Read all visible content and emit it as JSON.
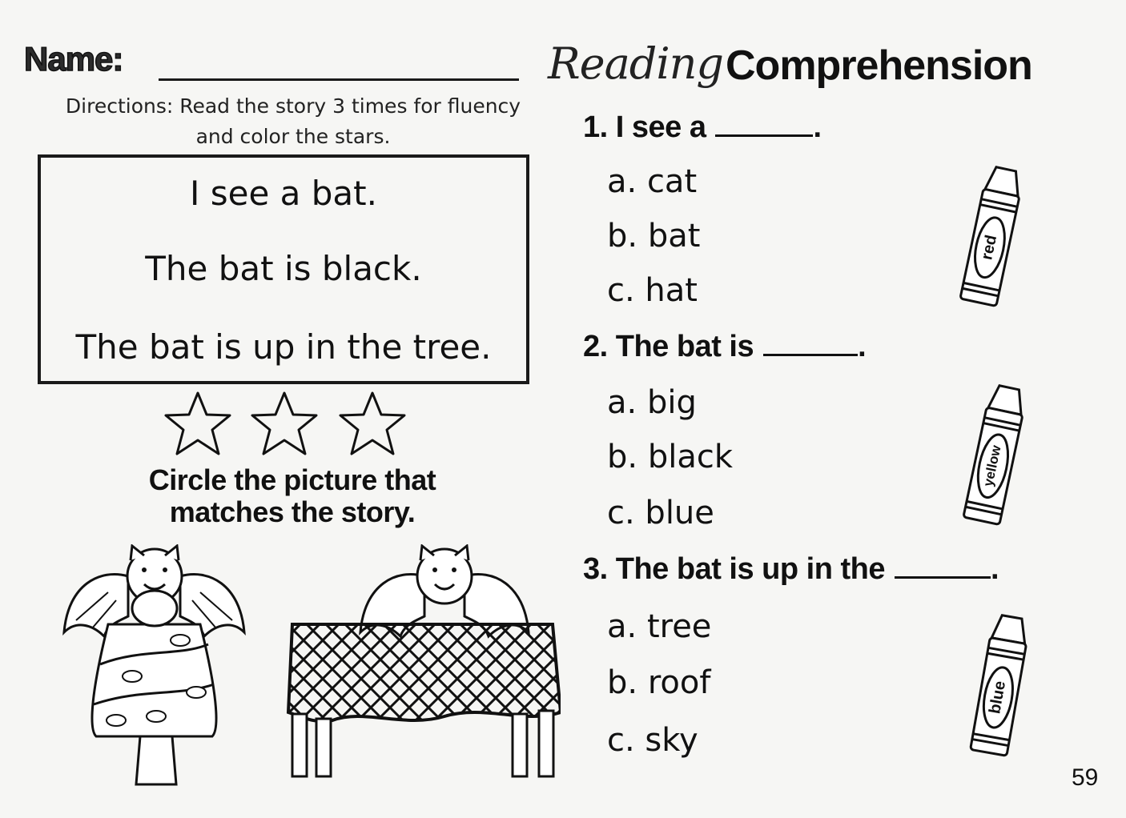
{
  "header": {
    "name_label": "Name:",
    "title_script": "Reading",
    "title_bold": "Comprehension"
  },
  "directions": {
    "line1": "Directions: Read the story 3 times for fluency",
    "line2": "and color the stars."
  },
  "story": {
    "lines": [
      "I see a bat.",
      "The bat is black.",
      "The bat is up in the tree."
    ]
  },
  "stars": {
    "count": 3,
    "colored": 0
  },
  "circle_instruction": {
    "line1": "Circle the picture that",
    "line2": "matches the story."
  },
  "pictures": [
    {
      "icon": "bat-in-tree-picture"
    },
    {
      "icon": "bat-on-table-picture"
    }
  ],
  "questions": [
    {
      "prompt": "1. I see a",
      "end": ".",
      "options": [
        "a. cat",
        "b. bat",
        "c. hat"
      ],
      "crayon_label": "red"
    },
    {
      "prompt": "2. The bat is",
      "end": ".",
      "options": [
        "a. big",
        "b. black",
        "c. blue"
      ],
      "crayon_label": "yellow"
    },
    {
      "prompt": "3. The bat is up in the",
      "end": ".",
      "options": [
        "a. tree",
        "b. roof",
        "c. sky"
      ],
      "crayon_label": "blue"
    }
  ],
  "page_number": "59",
  "colors": {
    "ink": "#111111",
    "paper": "#f6f6f4"
  }
}
